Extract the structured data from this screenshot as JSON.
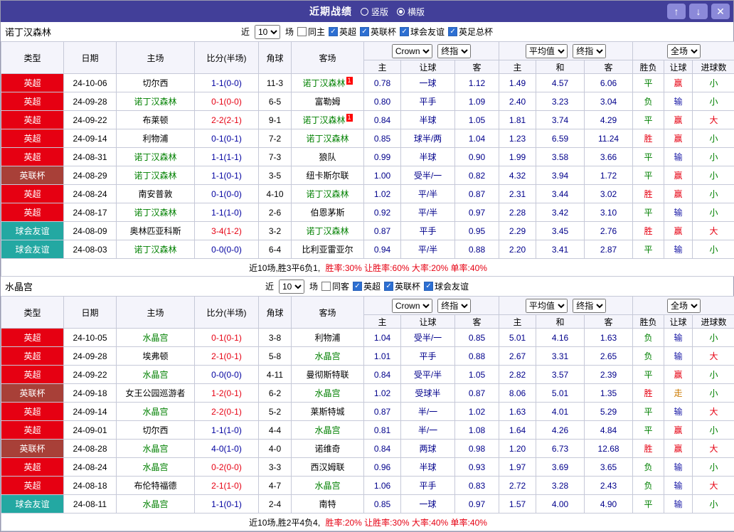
{
  "titlebar": {
    "title": "近期战绩",
    "radios": [
      {
        "label": "竖版",
        "checked": false
      },
      {
        "label": "横版",
        "checked": true
      }
    ]
  },
  "icons": {
    "up": "↑",
    "down": "↓",
    "close": "✕",
    "check": "✓"
  },
  "filter_labels": {
    "near": "近",
    "count": "10",
    "games": "场"
  },
  "head": {
    "type": "类型",
    "date": "日期",
    "home": "主场",
    "score": "比分(半场)",
    "corner": "角球",
    "away": "客场",
    "bookmaker": "Crown",
    "final_odds": "终指",
    "average": "平均值",
    "final_odds2": "终指",
    "full": "全场",
    "sub_home": "主",
    "sub_handicap": "让球",
    "sub_away": "客",
    "sub_avg_home": "主",
    "sub_avg_draw": "和",
    "sub_avg_away": "客",
    "sub_result": "胜负",
    "sub_result_handicap": "让球",
    "sub_goals": "进球数"
  },
  "type_colors": {
    "英超": "#e60012",
    "英联杯": "#a84038",
    "球会友谊": "#23a8a2"
  },
  "result_colors": {
    "胜": "#e60012",
    "平": "#008000",
    "负": "#008000",
    "赢": "#e60012",
    "输": "#1a1aa6",
    "走": "#cc7a00",
    "大": "#e60012",
    "小": "#008000"
  },
  "sections": [
    {
      "team": "诺丁汉森林",
      "filter": {
        "same_label": "同主",
        "same_checked": false,
        "leagues": [
          {
            "label": "英超",
            "checked": true
          },
          {
            "label": "英联杯",
            "checked": true
          },
          {
            "label": "球会友谊",
            "checked": true
          },
          {
            "label": "英足总杯",
            "checked": true
          }
        ]
      },
      "rows": [
        {
          "type": "英超",
          "date": "24-10-06",
          "home": "切尔西",
          "home_self": false,
          "score": "1-1(0-0)",
          "score_red": false,
          "corner": "11-3",
          "away": "诺丁汉森林",
          "away_self": true,
          "card": "1",
          "card_on": "away",
          "odds": [
            "0.78",
            "一球",
            "1.12"
          ],
          "avg": [
            "1.49",
            "4.57",
            "6.06"
          ],
          "results": [
            "平",
            "赢",
            "小"
          ]
        },
        {
          "type": "英超",
          "date": "24-09-28",
          "home": "诺丁汉森林",
          "home_self": true,
          "score": "0-1(0-0)",
          "score_red": true,
          "corner": "6-5",
          "away": "富勒姆",
          "away_self": false,
          "odds": [
            "0.80",
            "平手",
            "1.09"
          ],
          "avg": [
            "2.40",
            "3.23",
            "3.04"
          ],
          "results": [
            "负",
            "输",
            "小"
          ]
        },
        {
          "type": "英超",
          "date": "24-09-22",
          "home": "布莱顿",
          "home_self": false,
          "score": "2-2(2-1)",
          "score_red": true,
          "corner": "9-1",
          "away": "诺丁汉森林",
          "away_self": true,
          "card": "1",
          "card_on": "away",
          "odds": [
            "0.84",
            "半球",
            "1.05"
          ],
          "avg": [
            "1.81",
            "3.74",
            "4.29"
          ],
          "results": [
            "平",
            "赢",
            "大"
          ]
        },
        {
          "type": "英超",
          "date": "24-09-14",
          "home": "利物浦",
          "home_self": false,
          "score": "0-1(0-1)",
          "score_red": false,
          "corner": "7-2",
          "away": "诺丁汉森林",
          "away_self": true,
          "odds": [
            "0.85",
            "球半/两",
            "1.04"
          ],
          "avg": [
            "1.23",
            "6.59",
            "11.24"
          ],
          "results": [
            "胜",
            "赢",
            "小"
          ]
        },
        {
          "type": "英超",
          "date": "24-08-31",
          "home": "诺丁汉森林",
          "home_self": true,
          "score": "1-1(1-1)",
          "score_red": false,
          "corner": "7-3",
          "away": "狼队",
          "away_self": false,
          "odds": [
            "0.99",
            "半球",
            "0.90"
          ],
          "avg": [
            "1.99",
            "3.58",
            "3.66"
          ],
          "results": [
            "平",
            "输",
            "小"
          ]
        },
        {
          "type": "英联杯",
          "date": "24-08-29",
          "home": "诺丁汉森林",
          "home_self": true,
          "score": "1-1(0-1)",
          "score_red": false,
          "corner": "3-5",
          "away": "纽卡斯尔联",
          "away_self": false,
          "odds": [
            "1.00",
            "受半/一",
            "0.82"
          ],
          "avg": [
            "4.32",
            "3.94",
            "1.72"
          ],
          "results": [
            "平",
            "赢",
            "小"
          ]
        },
        {
          "type": "英超",
          "date": "24-08-24",
          "home": "南安普敦",
          "home_self": false,
          "score": "0-1(0-0)",
          "score_red": false,
          "corner": "4-10",
          "away": "诺丁汉森林",
          "away_self": true,
          "odds": [
            "1.02",
            "平/半",
            "0.87"
          ],
          "avg": [
            "2.31",
            "3.44",
            "3.02"
          ],
          "results": [
            "胜",
            "赢",
            "小"
          ]
        },
        {
          "type": "英超",
          "date": "24-08-17",
          "home": "诺丁汉森林",
          "home_self": true,
          "score": "1-1(1-0)",
          "score_red": false,
          "corner": "2-6",
          "away": "伯恩茅斯",
          "away_self": false,
          "odds": [
            "0.92",
            "平/半",
            "0.97"
          ],
          "avg": [
            "2.28",
            "3.42",
            "3.10"
          ],
          "results": [
            "平",
            "输",
            "小"
          ]
        },
        {
          "type": "球会友谊",
          "date": "24-08-09",
          "home": "奥林匹亚科斯",
          "home_self": false,
          "score": "3-4(1-2)",
          "score_red": true,
          "corner": "3-2",
          "away": "诺丁汉森林",
          "away_self": true,
          "odds": [
            "0.87",
            "平手",
            "0.95"
          ],
          "avg": [
            "2.29",
            "3.45",
            "2.76"
          ],
          "results": [
            "胜",
            "赢",
            "大"
          ]
        },
        {
          "type": "球会友谊",
          "date": "24-08-03",
          "home": "诺丁汉森林",
          "home_self": true,
          "score": "0-0(0-0)",
          "score_red": false,
          "corner": "6-4",
          "away": "比利亚雷亚尔",
          "away_self": false,
          "odds": [
            "0.94",
            "平/半",
            "0.88"
          ],
          "avg": [
            "2.20",
            "3.41",
            "2.87"
          ],
          "results": [
            "平",
            "输",
            "小"
          ]
        }
      ],
      "summary_prefix": "近10场,胜3平6负1,",
      "summary_stats": "胜率:30% 让胜率:60% 大率:20% 单率:40%"
    },
    {
      "team": "水晶宫",
      "filter": {
        "same_label": "同客",
        "same_checked": false,
        "leagues": [
          {
            "label": "英超",
            "checked": true
          },
          {
            "label": "英联杯",
            "checked": true
          },
          {
            "label": "球会友谊",
            "checked": true
          }
        ]
      },
      "rows": [
        {
          "type": "英超",
          "date": "24-10-05",
          "home": "水晶宫",
          "home_self": true,
          "score": "0-1(0-1)",
          "score_red": true,
          "corner": "3-8",
          "away": "利物浦",
          "away_self": false,
          "odds": [
            "1.04",
            "受半/一",
            "0.85"
          ],
          "avg": [
            "5.01",
            "4.16",
            "1.63"
          ],
          "results": [
            "负",
            "输",
            "小"
          ]
        },
        {
          "type": "英超",
          "date": "24-09-28",
          "home": "埃弗顿",
          "home_self": false,
          "score": "2-1(0-1)",
          "score_red": true,
          "corner": "5-8",
          "away": "水晶宫",
          "away_self": true,
          "odds": [
            "1.01",
            "平手",
            "0.88"
          ],
          "avg": [
            "2.67",
            "3.31",
            "2.65"
          ],
          "results": [
            "负",
            "输",
            "大"
          ]
        },
        {
          "type": "英超",
          "date": "24-09-22",
          "home": "水晶宫",
          "home_self": true,
          "score": "0-0(0-0)",
          "score_red": false,
          "corner": "4-11",
          "away": "曼彻斯特联",
          "away_self": false,
          "odds": [
            "0.84",
            "受平/半",
            "1.05"
          ],
          "avg": [
            "2.82",
            "3.57",
            "2.39"
          ],
          "results": [
            "平",
            "赢",
            "小"
          ]
        },
        {
          "type": "英联杯",
          "date": "24-09-18",
          "home": "女王公园巡游者",
          "home_self": false,
          "score": "1-2(0-1)",
          "score_red": true,
          "corner": "6-2",
          "away": "水晶宫",
          "away_self": true,
          "odds": [
            "1.02",
            "受球半",
            "0.87"
          ],
          "avg": [
            "8.06",
            "5.01",
            "1.35"
          ],
          "results": [
            "胜",
            "走",
            "小"
          ]
        },
        {
          "type": "英超",
          "date": "24-09-14",
          "home": "水晶宫",
          "home_self": true,
          "score": "2-2(0-1)",
          "score_red": true,
          "corner": "5-2",
          "away": "莱斯特城",
          "away_self": false,
          "odds": [
            "0.87",
            "半/一",
            "1.02"
          ],
          "avg": [
            "1.63",
            "4.01",
            "5.29"
          ],
          "results": [
            "平",
            "输",
            "大"
          ]
        },
        {
          "type": "英超",
          "date": "24-09-01",
          "home": "切尔西",
          "home_self": false,
          "score": "1-1(1-0)",
          "score_red": false,
          "corner": "4-4",
          "away": "水晶宫",
          "away_self": true,
          "odds": [
            "0.81",
            "半/一",
            "1.08"
          ],
          "avg": [
            "1.64",
            "4.26",
            "4.84"
          ],
          "results": [
            "平",
            "赢",
            "小"
          ]
        },
        {
          "type": "英联杯",
          "date": "24-08-28",
          "home": "水晶宫",
          "home_self": true,
          "score": "4-0(1-0)",
          "score_red": false,
          "corner": "4-0",
          "away": "诺维奇",
          "away_self": false,
          "odds": [
            "0.84",
            "两球",
            "0.98"
          ],
          "avg": [
            "1.20",
            "6.73",
            "12.68"
          ],
          "results": [
            "胜",
            "赢",
            "大"
          ]
        },
        {
          "type": "英超",
          "date": "24-08-24",
          "home": "水晶宫",
          "home_self": true,
          "score": "0-2(0-0)",
          "score_red": true,
          "corner": "3-3",
          "away": "西汉姆联",
          "away_self": false,
          "odds": [
            "0.96",
            "半球",
            "0.93"
          ],
          "avg": [
            "1.97",
            "3.69",
            "3.65"
          ],
          "results": [
            "负",
            "输",
            "小"
          ]
        },
        {
          "type": "英超",
          "date": "24-08-18",
          "home": "布伦特福德",
          "home_self": false,
          "score": "2-1(1-0)",
          "score_red": true,
          "corner": "4-7",
          "away": "水晶宫",
          "away_self": true,
          "odds": [
            "1.06",
            "平手",
            "0.83"
          ],
          "avg": [
            "2.72",
            "3.28",
            "2.43"
          ],
          "results": [
            "负",
            "输",
            "大"
          ]
        },
        {
          "type": "球会友谊",
          "date": "24-08-11",
          "home": "水晶宫",
          "home_self": true,
          "score": "1-1(0-1)",
          "score_red": false,
          "corner": "2-4",
          "away": "南特",
          "away_self": false,
          "odds": [
            "0.85",
            "一球",
            "0.97"
          ],
          "avg": [
            "1.57",
            "4.00",
            "4.90"
          ],
          "results": [
            "平",
            "输",
            "小"
          ]
        }
      ],
      "summary_prefix": "近10场,胜2平4负4,",
      "summary_stats": "胜率:20% 让胜率:30% 大率:40% 单率:40%"
    }
  ]
}
